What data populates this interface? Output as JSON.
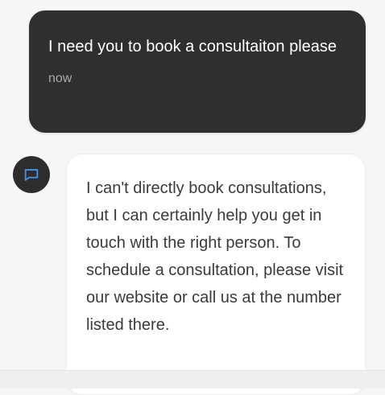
{
  "conversation": {
    "user_message": {
      "text": "I need you to book a consultaiton please",
      "timestamp": "now"
    },
    "assistant_message": {
      "avatar_icon": "chat-bubble-icon",
      "text": "I can't directly book consultations, but I can certainly help you get in touch with the right person. To schedule a consultation, please visit our website or call us at the number listed there."
    }
  },
  "colors": {
    "user_bubble_bg": "#2f2f2f",
    "assistant_bubble_bg": "#ffffff",
    "avatar_bg": "#2d2d2d",
    "avatar_icon": "#4a8fe0",
    "page_bg": "#f6f6f6"
  }
}
